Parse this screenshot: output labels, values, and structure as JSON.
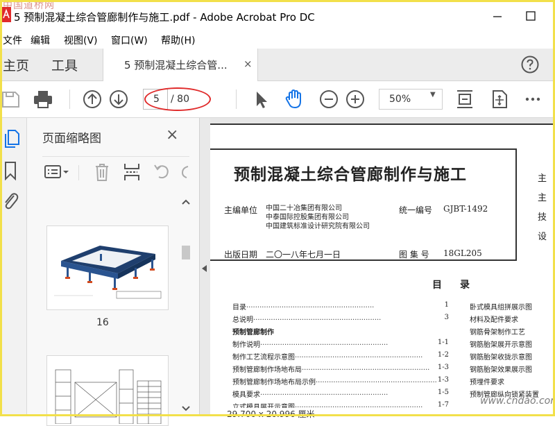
{
  "window": {
    "title": "5 预制混凝土综合管廊制作与施工.pdf - Adobe Acrobat Pro DC",
    "watermark_top": "中国道桥网",
    "watermark_bottom": "www.cndao.com"
  },
  "menu": [
    "文件",
    "编辑",
    "视图(V)",
    "窗口(W)",
    "帮助(H)"
  ],
  "tabs": {
    "home": "主页",
    "tools": "工具",
    "document": "5 预制混凝土综合管...",
    "close": "×"
  },
  "toolbar": {
    "page_current": "5",
    "page_total": "/ 80",
    "zoom": "50%"
  },
  "thumbnails": {
    "title": "页面缩略图",
    "close": "×",
    "page_label": "16"
  },
  "colors": {
    "accent_blue": "#1473e6",
    "annotation_red": "#e02b2b",
    "frame_yellow": "#f2e04a"
  },
  "document": {
    "title": "预制混凝土综合管廊制作与施工",
    "editor_label": "主编单位",
    "editors": [
      "中国二十冶集团有限公司",
      "中泰国际控股集团有限公司",
      "中国建筑标准设计研究院有限公司"
    ],
    "unified_no_label": "统一编号",
    "unified_no": "GJBT-1492",
    "pub_date_label": "出版日期",
    "pub_date": "二〇一八年七月一日",
    "atlas_no_label": "图 集 号",
    "atlas_no": "18GL205",
    "right_column": [
      "主",
      "主",
      "技",
      "设"
    ],
    "toc_title": "目录",
    "toc_left": [
      {
        "text": "目录",
        "page": "1"
      },
      {
        "text": "总说明",
        "page": "3"
      },
      {
        "text": "预制管廊制作",
        "page": ""
      },
      {
        "text": "制作说明",
        "page": "1-1"
      },
      {
        "text": "制作工艺流程示意图",
        "page": "1-2"
      },
      {
        "text": "预制管廊制作场地布局",
        "page": "1-3"
      },
      {
        "text": "预制管廊制作场地布局示例",
        "page": "1-3"
      },
      {
        "text": "模具要求",
        "page": "1-5"
      },
      {
        "text": "立式模具展开示意图",
        "page": "1-7"
      }
    ],
    "toc_right": [
      "卧式模具组拼展示图",
      "材料及配件要求",
      "钢筋骨架制作工艺",
      "钢筋胎架展开示意图",
      "钢筋胎架收拢示意图",
      "钢筋胎架效果展示图",
      "预埋件要求",
      "预制管廊纵向锁紧装置"
    ]
  },
  "status": {
    "page_size": "29.700 x 20.996 厘米"
  }
}
